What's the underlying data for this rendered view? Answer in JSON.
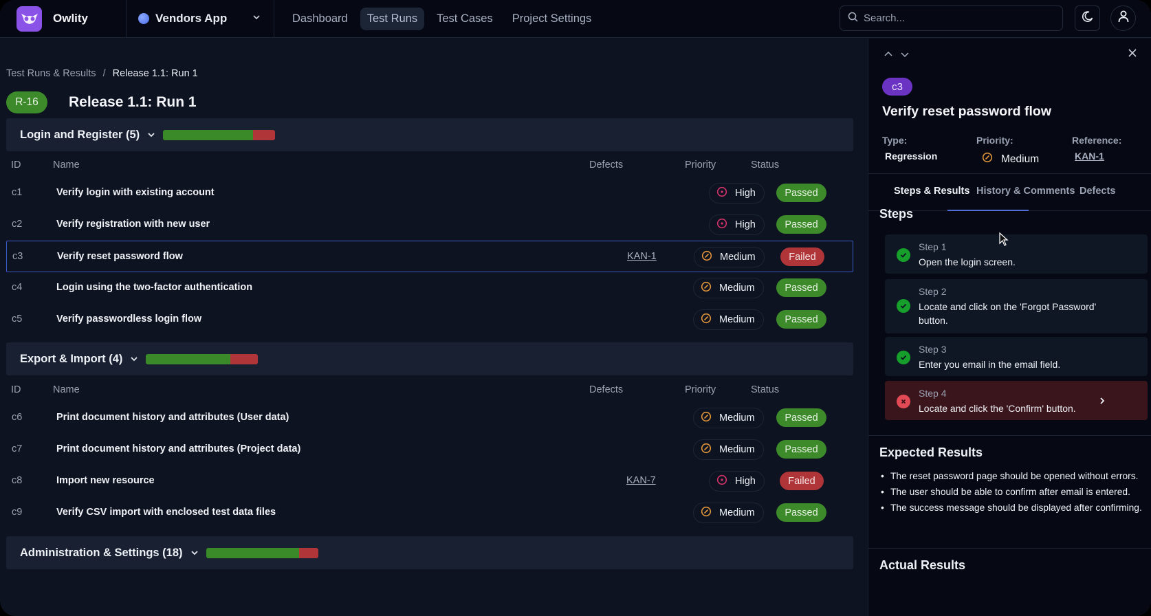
{
  "app": {
    "brand": "Owlity",
    "project": "Vendors App",
    "nav": [
      {
        "label": "Dashboard",
        "active": false
      },
      {
        "label": "Test Runs",
        "active": true
      },
      {
        "label": "Test Cases",
        "active": false
      },
      {
        "label": "Project Settings",
        "active": false
      }
    ],
    "search_placeholder": "Search...",
    "icons": {
      "search": "search-icon",
      "theme": "moon-icon",
      "user": "user-icon",
      "project_dropdown": "chevron-down-icon"
    }
  },
  "breadcrumb": {
    "parent": "Test Runs & Results",
    "separator": "/",
    "current": "Release 1.1: Run 1"
  },
  "run": {
    "id": "R-16",
    "title": "Release 1.1: Run 1"
  },
  "columns": {
    "id": "ID",
    "name": "Name",
    "defects": "Defects",
    "priority": "Priority",
    "status": "Status"
  },
  "groups": [
    {
      "title": "Login and Register (5)",
      "pass_fraction": 0.8,
      "fail_fraction": 0.2,
      "rows": [
        {
          "id": "c1",
          "name": "Verify login with existing account",
          "defect": "",
          "priority": "High",
          "status": "Passed"
        },
        {
          "id": "c2",
          "name": "Verify registration with new user",
          "defect": "",
          "priority": "High",
          "status": "Passed"
        },
        {
          "id": "c3",
          "name": "Verify reset password flow",
          "defect": "KAN-1",
          "priority": "Medium",
          "status": "Failed",
          "selected": true
        },
        {
          "id": "c4",
          "name": "Login using the two-factor authentication",
          "defect": "",
          "priority": "Medium",
          "status": "Passed"
        },
        {
          "id": "c5",
          "name": "Verify passwordless login flow",
          "defect": "",
          "priority": "Medium",
          "status": "Passed"
        }
      ]
    },
    {
      "title": "Export & Import (4)",
      "pass_fraction": 0.75,
      "fail_fraction": 0.25,
      "rows": [
        {
          "id": "c6",
          "name": "Print document history and attributes (User data)",
          "defect": "",
          "priority": "Medium",
          "status": "Passed"
        },
        {
          "id": "c7",
          "name": "Print document history and attributes (Project data)",
          "defect": "",
          "priority": "Medium",
          "status": "Passed"
        },
        {
          "id": "c8",
          "name": "Import new resource",
          "defect": "KAN-7",
          "priority": "High",
          "status": "Failed"
        },
        {
          "id": "c9",
          "name": "Verify CSV import with enclosed test data files",
          "defect": "",
          "priority": "Medium",
          "status": "Passed"
        }
      ]
    },
    {
      "title": "Administration & Settings (18)",
      "pass_fraction": 0.83,
      "fail_fraction": 0.17,
      "rows": []
    }
  ],
  "panel": {
    "case_id": "c3",
    "title": "Verify reset password flow",
    "type_label": "Type:",
    "type_value": "Regression",
    "priority_label": "Priority:",
    "priority_value": "Medium",
    "reference_label": "Reference:",
    "reference_value": "KAN-1",
    "tabs": [
      "Steps & Results",
      "History & Comments",
      "Defects"
    ],
    "active_tab": 0,
    "steps_title": "Steps",
    "steps": [
      {
        "label": "Step 1",
        "text": "Open the login screen.",
        "result": "passed"
      },
      {
        "label": "Step 2",
        "text": "Locate and click on the 'Forgot Password' button.",
        "result": "passed"
      },
      {
        "label": "Step 3",
        "text": "Enter you email in the email field.",
        "result": "passed"
      },
      {
        "label": "Step 4",
        "text": "Locate and click the 'Confirm' button.",
        "result": "failed"
      }
    ],
    "expected_title": "Expected Results",
    "expected": [
      "The reset password page should be opened without errors.",
      "The user should be able to confirm after email is entered.",
      "The success message should be displayed after confirming."
    ],
    "actual_title": "Actual Results"
  },
  "colors": {
    "passed": "#3d8a2b",
    "failed": "#b03539",
    "accent": "#4f6fd6",
    "brand": "#8b52e8",
    "high_priority": "#d6336c",
    "medium_priority": "#e0953a"
  }
}
